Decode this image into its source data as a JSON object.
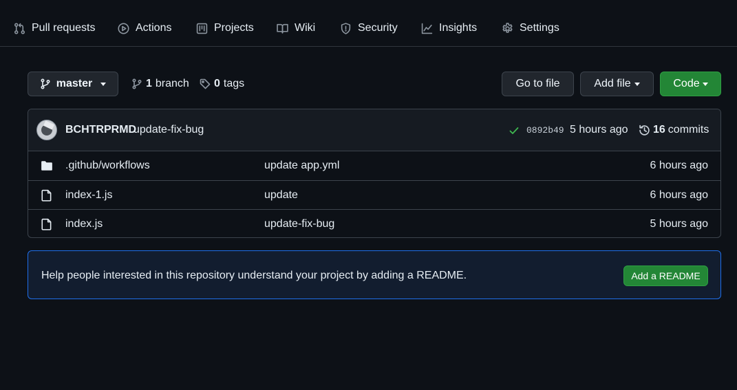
{
  "nav": {
    "items": [
      {
        "label": "Pull requests",
        "icon": "pull-request-icon"
      },
      {
        "label": "Actions",
        "icon": "play-circle-icon"
      },
      {
        "label": "Projects",
        "icon": "project-board-icon"
      },
      {
        "label": "Wiki",
        "icon": "book-icon"
      },
      {
        "label": "Security",
        "icon": "shield-icon"
      },
      {
        "label": "Insights",
        "icon": "graph-icon"
      },
      {
        "label": "Settings",
        "icon": "gear-icon"
      }
    ]
  },
  "toolbar": {
    "branch": "master",
    "branch_count": "1",
    "branch_word": "branch",
    "tag_count": "0",
    "tag_word": "tags",
    "go_to_file": "Go to file",
    "add_file": "Add file",
    "code": "Code"
  },
  "commit": {
    "author": "BCHTRPRMD",
    "message": "update-fix-bug",
    "sha": "0892b49",
    "time": "5 hours ago",
    "count": "16",
    "count_word": "commits",
    "status": "success"
  },
  "files": [
    {
      "type": "folder",
      "name": ".github/workflows",
      "message": "update app.yml",
      "time": "6 hours ago"
    },
    {
      "type": "file",
      "name": "index-1.js",
      "message": "update",
      "time": "6 hours ago"
    },
    {
      "type": "file",
      "name": "index.js",
      "message": "update-fix-bug",
      "time": "5 hours ago"
    }
  ],
  "readme_banner": {
    "text": "Help people interested in this repository understand your project by adding a README.",
    "button": "Add a README"
  },
  "colors": {
    "background": "#0d1117",
    "border": "#3d444d",
    "green": "#238636",
    "success_check": "#3fb950",
    "banner_bg": "#121d2f",
    "banner_border": "#1f6feb"
  }
}
